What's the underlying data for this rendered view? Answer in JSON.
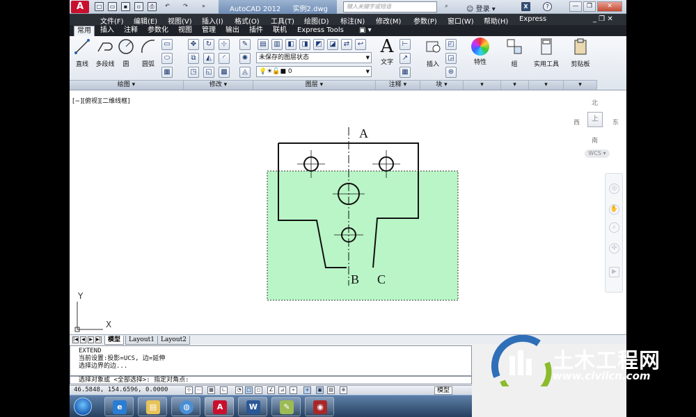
{
  "titlebar": {
    "logo": "A",
    "title": "AutoCAD 2012",
    "file": "实例2.dwg",
    "search_placeholder": "键入关键字或短语",
    "login": "登录"
  },
  "menu": [
    "文件(F)",
    "编辑(E)",
    "视图(V)",
    "插入(I)",
    "格式(O)",
    "工具(T)",
    "绘图(D)",
    "标注(N)",
    "修改(M)",
    "参数(P)",
    "窗口(W)",
    "帮助(H)",
    "Express"
  ],
  "ribbon_tabs": [
    "常用",
    "插入",
    "注释",
    "参数化",
    "视图",
    "管理",
    "输出",
    "插件",
    "联机",
    "Express Tools"
  ],
  "ribbon": {
    "draw_tools": [
      "直线",
      "多段线",
      "圆",
      "圆弧"
    ],
    "layer_state": "未保存的图层状态",
    "layer_current": "0",
    "text_label": "文字",
    "insert_label": "插入",
    "properties_label": "特性",
    "group_label": "组",
    "utilities_label": "实用工具",
    "clipboard_label": "剪贴板",
    "panels": [
      "绘图",
      "修改",
      "图层",
      "注释",
      "块"
    ]
  },
  "viewport": {
    "label": "[−][俯视][二维线框]",
    "compass": {
      "north": "北",
      "south": "南",
      "east": "东",
      "west": "西",
      "top": "上"
    },
    "wcs": "WCS"
  },
  "drawing_labels": {
    "a": "A",
    "b": "B",
    "c": "C",
    "ucs_x": "X",
    "ucs_y": "Y"
  },
  "layout_tabs": [
    "模型",
    "Layout1",
    "Layout2"
  ],
  "command": {
    "history": [
      "EXTEND",
      "当前设置:投影=UCS, 边=延伸",
      "选择边界的边..."
    ],
    "prompt": "选择对象或 <全部选择>:  指定对角点:"
  },
  "status": {
    "coords": "46.5848,  154.6596, 0.0000",
    "model": "模型"
  },
  "watermark": {
    "title": "土木工程网",
    "url": "www.civilcn.com"
  },
  "colors": {
    "selection_fill": "#b9f5c6",
    "menubar": "#2b2f36",
    "accent_red": "#c8102e"
  }
}
